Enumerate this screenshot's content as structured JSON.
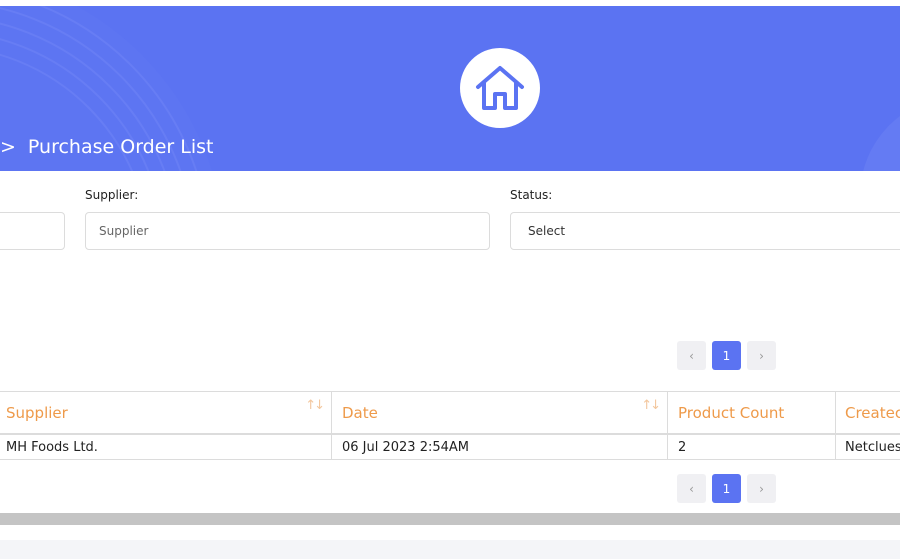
{
  "header": {
    "breadcrumb_separator": ">",
    "breadcrumb_current": "Purchase Order List",
    "icon": "home-icon"
  },
  "filters": {
    "supplier_label": "Supplier:",
    "supplier_placeholder": "Supplier",
    "status_label": "Status:",
    "status_value": "Select"
  },
  "pagination_top": {
    "prev": "‹",
    "current": "1",
    "next": "›"
  },
  "pagination_bottom": {
    "prev": "‹",
    "current": "1",
    "next": "›"
  },
  "table": {
    "columns": [
      "Supplier",
      "Date",
      "Product Count",
      "Createc"
    ],
    "sort_glyph": "↑↓",
    "rows": [
      [
        "MH Foods Ltd.",
        "06 Jul 2023 2:54AM",
        "2",
        "Netclues"
      ]
    ]
  },
  "colors": {
    "banner": "#5b73f2",
    "accent_header_text": "#ee9a4a",
    "pager_active": "#5b73f2"
  }
}
